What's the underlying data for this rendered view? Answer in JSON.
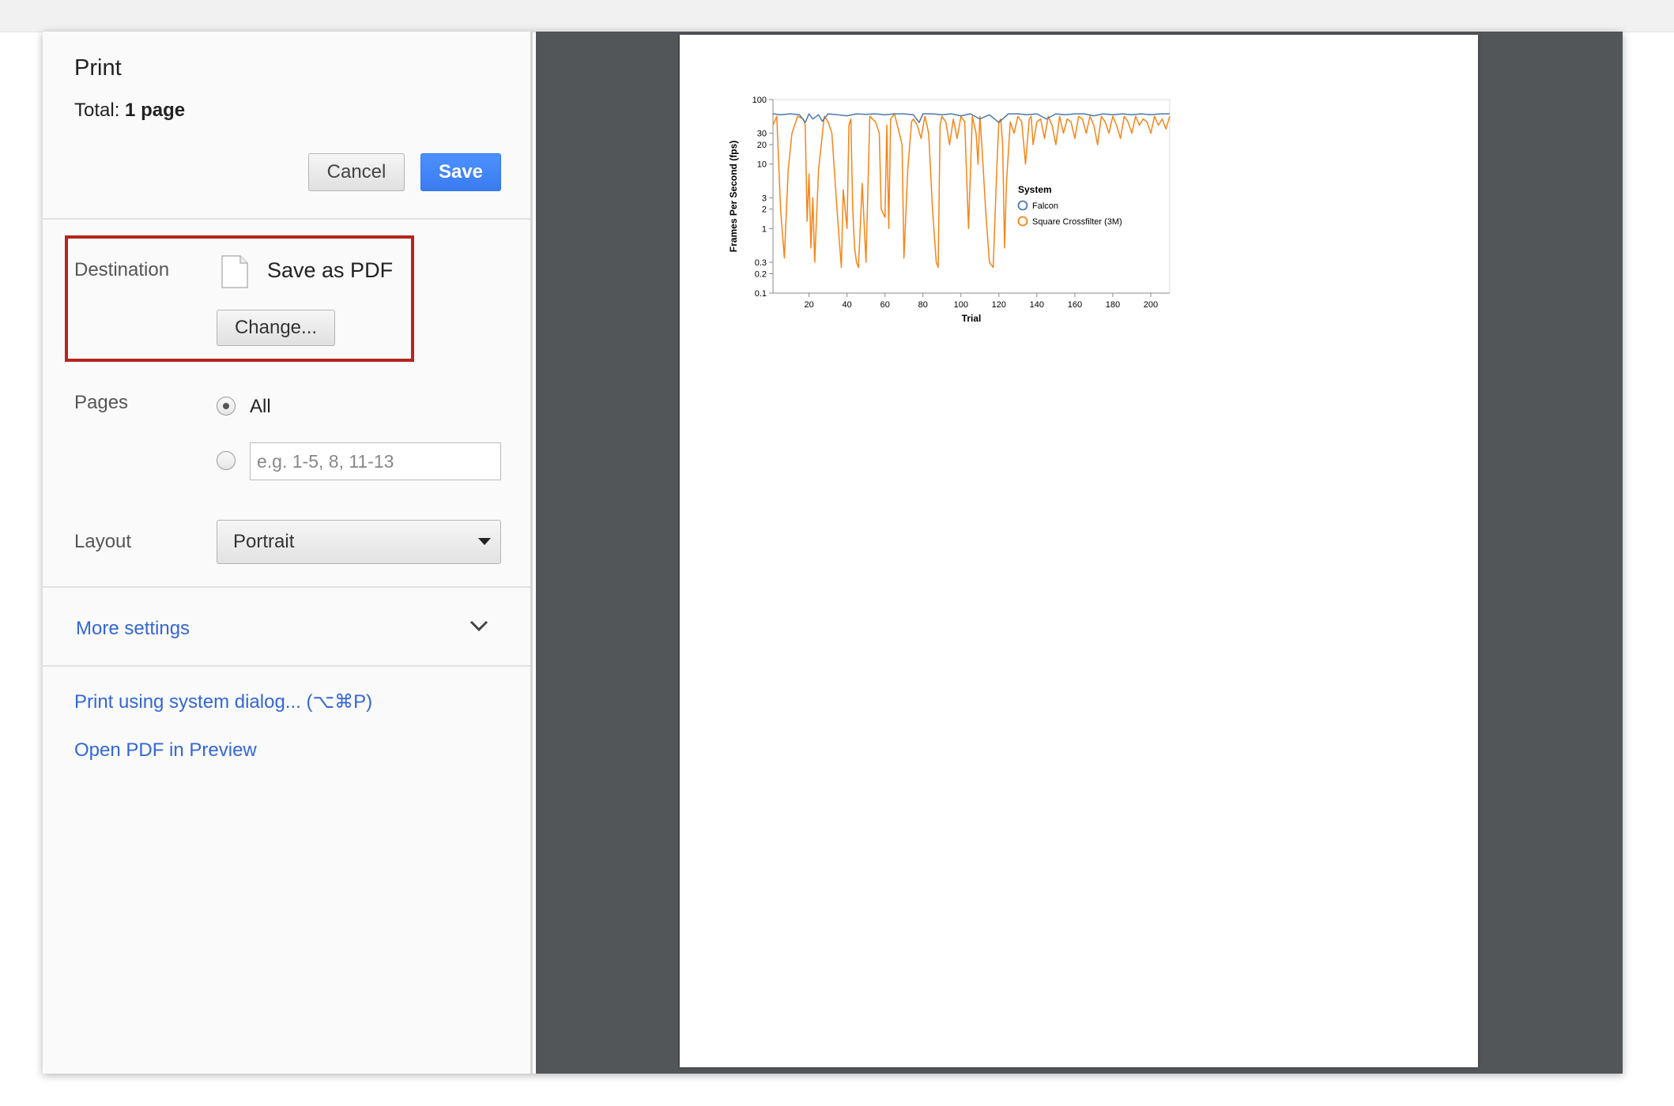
{
  "dialog": {
    "title": "Print",
    "total_label": "Total:",
    "total_value": "1 page",
    "cancel_label": "Cancel",
    "save_label": "Save"
  },
  "destination": {
    "label": "Destination",
    "value": "Save as PDF",
    "change_label": "Change...",
    "icon": "file-icon"
  },
  "pages": {
    "label": "Pages",
    "all_label": "All",
    "selected": "All",
    "custom_placeholder": "e.g. 1-5, 8, 11-13"
  },
  "layout": {
    "label": "Layout",
    "value": "Portrait"
  },
  "more_settings": {
    "label": "More settings",
    "icon": "chevron-down-icon"
  },
  "links": {
    "system_dialog": "Print using system dialog... (⌥⌘P)",
    "open_preview": "Open PDF in Preview"
  },
  "colors": {
    "accent": "#3367d6",
    "save_button": "#4d90fe",
    "highlight_border": "#b3261e",
    "preview_background": "#525659",
    "falcon": "#4c78a8",
    "crossfilter": "#f58518"
  },
  "chart_data": {
    "type": "line",
    "xlabel": "Trial",
    "ylabel": "Frames Per Second (fps)",
    "xlim": [
      1,
      210
    ],
    "ylim": [
      0.1,
      100
    ],
    "yscale": "log",
    "x_ticks": [
      20,
      40,
      60,
      80,
      100,
      120,
      140,
      160,
      180,
      200
    ],
    "y_ticks": [
      {
        "v": 0.1,
        "label": "0.1"
      },
      {
        "v": 0.2,
        "label": "0.2"
      },
      {
        "v": 0.3,
        "label": "0.3"
      },
      {
        "v": 1,
        "label": "1"
      },
      {
        "v": 2,
        "label": "2"
      },
      {
        "v": 3,
        "label": "3"
      },
      {
        "v": 10,
        "label": "10"
      },
      {
        "v": 20,
        "label": "20"
      },
      {
        "v": 30,
        "label": "30"
      },
      {
        "v": 100,
        "label": "100"
      }
    ],
    "legend": {
      "title": "System",
      "position": "bottom-right"
    },
    "series": [
      {
        "name": "Falcon",
        "color": "#4c78a8",
        "x": [
          1,
          5,
          10,
          15,
          18,
          20,
          22,
          25,
          27,
          30,
          35,
          40,
          45,
          50,
          55,
          60,
          65,
          70,
          75,
          78,
          80,
          85,
          90,
          95,
          100,
          105,
          110,
          115,
          120,
          125,
          130,
          135,
          140,
          145,
          150,
          155,
          160,
          165,
          170,
          175,
          180,
          185,
          190,
          195,
          200,
          205,
          210
        ],
        "values": [
          60,
          58,
          60,
          58,
          44,
          60,
          50,
          58,
          46,
          60,
          58,
          56,
          60,
          59,
          60,
          58,
          60,
          60,
          58,
          44,
          60,
          60,
          58,
          60,
          56,
          60,
          50,
          58,
          44,
          60,
          60,
          58,
          60,
          50,
          60,
          58,
          60,
          60,
          56,
          60,
          58,
          60,
          58,
          60,
          58,
          60,
          60
        ]
      },
      {
        "name": "Square Crossfilter (3M)",
        "color": "#f58518",
        "x": [
          1,
          3,
          5,
          7,
          9,
          11,
          14,
          17,
          18,
          19,
          20,
          21,
          22,
          23,
          25,
          28,
          30,
          32,
          35,
          37,
          38,
          40,
          41,
          42,
          43,
          44,
          45,
          46,
          48,
          50,
          52,
          55,
          57,
          58,
          60,
          61,
          62,
          63,
          65,
          67,
          69,
          70,
          72,
          74,
          75,
          77,
          79,
          81,
          83,
          85,
          87,
          88,
          89,
          90,
          92,
          94,
          96,
          98,
          100,
          102,
          104,
          106,
          108,
          109,
          110,
          111,
          113,
          115,
          117,
          119,
          120,
          121,
          122,
          123,
          124,
          126,
          128,
          130,
          132,
          134,
          136,
          137,
          138,
          140,
          142,
          144,
          146,
          148,
          150,
          152,
          154,
          156,
          158,
          160,
          162,
          164,
          166,
          168,
          170,
          172,
          174,
          176,
          178,
          180,
          182,
          184,
          186,
          188,
          190,
          192,
          194,
          196,
          198,
          200,
          202,
          204,
          206,
          208,
          210
        ],
        "values": [
          40,
          55,
          2,
          0.35,
          8,
          30,
          55,
          50,
          40,
          1.3,
          7,
          0.5,
          3,
          0.3,
          8,
          55,
          45,
          30,
          1.5,
          0.25,
          4,
          1,
          40,
          50,
          2,
          0.5,
          0.3,
          0.25,
          5,
          0.3,
          55,
          45,
          30,
          2,
          1.5,
          40,
          1,
          50,
          60,
          35,
          20,
          0.35,
          8,
          45,
          50,
          40,
          25,
          55,
          30,
          2,
          0.3,
          0.25,
          40,
          55,
          45,
          20,
          50,
          25,
          55,
          45,
          1,
          55,
          30,
          10,
          55,
          20,
          2,
          0.3,
          0.25,
          10,
          45,
          50,
          20,
          0.5,
          5,
          45,
          30,
          55,
          45,
          10,
          50,
          55,
          20,
          45,
          50,
          25,
          55,
          40,
          20,
          55,
          30,
          50,
          45,
          25,
          55,
          50,
          30,
          55,
          40,
          20,
          55,
          45,
          30,
          55,
          40,
          25,
          55,
          45,
          30,
          55,
          40,
          50,
          45,
          30,
          55,
          40,
          50,
          35,
          55
        ]
      }
    ]
  }
}
